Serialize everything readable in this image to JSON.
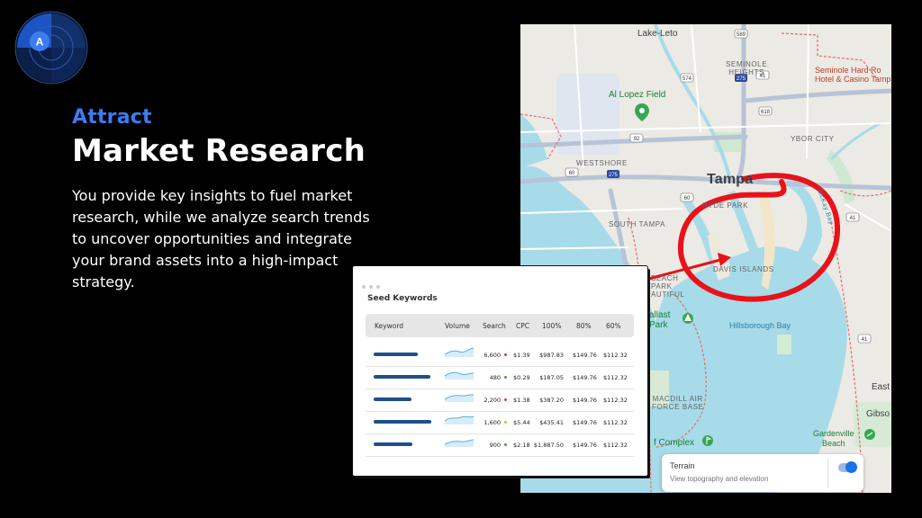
{
  "logo": {
    "letter": "A"
  },
  "hero": {
    "subtitle": "Attract",
    "title": "Market Research",
    "description": "You provide key insights to fuel market research, while we analyze search trends to uncover opportunities and integrate your brand assets into a high-impact strategy."
  },
  "map": {
    "labels": {
      "lake_leto": "Lake-Leto",
      "seminole_heights": "SEMINOLE\nHEIGHTS",
      "seminole_hard_rock": "Seminole Hard Ro\nHotel & Casino Tamp",
      "al_lopez": "Al Lopez Field",
      "ybor": "YBOR CITY",
      "westshore": "WESTSHORE",
      "tampa": "Tampa",
      "hyde_park": "HYDE PARK",
      "south_tampa": "SOUTH TAMPA",
      "davis_islands": "DAVIS ISLANDS",
      "beach_park": "BEACH\nPARK\nAUTIFUL",
      "ballast": "allast\nPark",
      "hillsborough_bay": "Hillsborough Bay",
      "macdill": "MACDILL AIR\nFORCE BASE",
      "complex": "f Complex",
      "east": "East",
      "gibso": "Gibso",
      "gardenville": "Gardenville\nBeach",
      "mckay": "McKay Bay"
    },
    "route_shields": [
      "589",
      "275",
      "574",
      "41",
      "60",
      "92",
      "275",
      "60",
      "41",
      "618",
      "41"
    ],
    "terrain": {
      "label": "Terrain",
      "description": "View topography and elevation",
      "enabled": true
    }
  },
  "card": {
    "title": "Seed Keywords",
    "columns": [
      "Keyword",
      "Volume",
      "Search",
      "CPC",
      "100%",
      "80%",
      "60%"
    ],
    "rows": [
      {
        "bar": 0.7,
        "search": "6,600",
        "dot": "red",
        "cpc": "$1.39",
        "c100": "$987.83",
        "c80": "$149.76",
        "c60": "$112.32"
      },
      {
        "bar": 0.9,
        "search": "480",
        "dot": "green",
        "cpc": "$0.29",
        "c100": "$187.05",
        "c80": "$149.76",
        "c60": "$112.32"
      },
      {
        "bar": 0.6,
        "search": "2,200",
        "dot": "red",
        "cpc": "$1.38",
        "c100": "$387.20",
        "c80": "$149.76",
        "c60": "$112.32"
      },
      {
        "bar": 0.92,
        "search": "1,600",
        "dot": "yellow",
        "cpc": "$5.44",
        "c100": "$435.41",
        "c80": "$149.76",
        "c60": "$112.32"
      },
      {
        "bar": 0.62,
        "search": "900",
        "dot": "green",
        "cpc": "$2.18",
        "c100": "$1,887.50",
        "c80": "$149.76",
        "c60": "$112.32"
      }
    ]
  },
  "colors": {
    "accent": "#3d7bf2",
    "annotation_red": "#e8121b",
    "bar_blue": "#1f4e8c",
    "water": "#a8dbe9",
    "dot_red": "#e53935",
    "dot_green": "#43a047",
    "dot_yellow": "#f9a825"
  }
}
